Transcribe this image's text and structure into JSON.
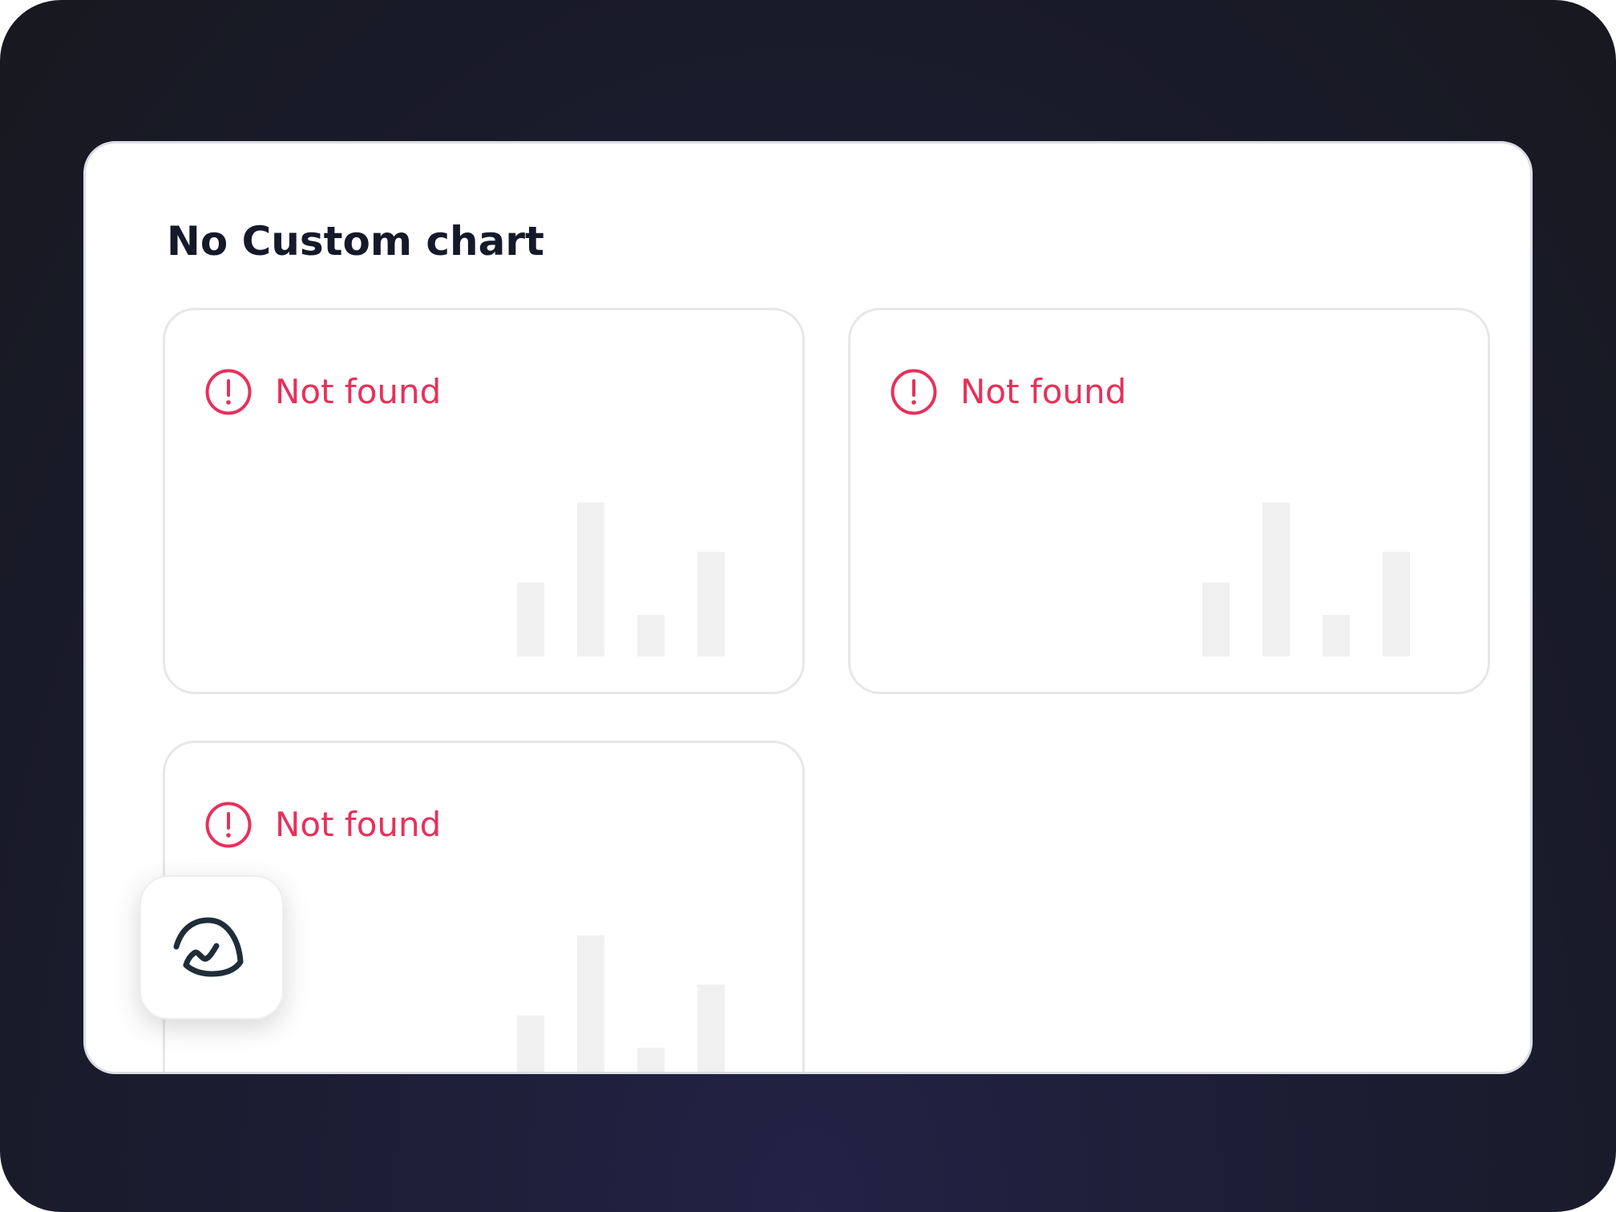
{
  "panel": {
    "title": "No Custom chart"
  },
  "cards": [
    {
      "message": "Not found",
      "icon": "alert-circle-icon",
      "placeholder_bars": [
        0.48,
        1.0,
        0.27,
        0.68
      ]
    },
    {
      "message": "Not found",
      "icon": "alert-circle-icon",
      "placeholder_bars": [
        0.48,
        1.0,
        0.27,
        0.68
      ]
    },
    {
      "message": "Not found",
      "icon": "alert-circle-icon",
      "placeholder_bars": [
        0.48,
        1.0,
        0.27,
        0.68
      ]
    }
  ],
  "logo": {
    "icon": "basecamp-logo-icon"
  },
  "colors": {
    "error": "#e6315b",
    "title": "#141a2a",
    "placeholder_bar": "#f0f0f0",
    "frame_background": "#1c1d33",
    "logo": "#1f2d38"
  }
}
